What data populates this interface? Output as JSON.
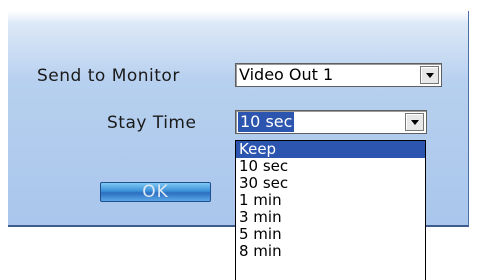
{
  "dialog": {
    "send_label": "Send to Monitor",
    "send_value": "Video Out 1",
    "stay_label": "Stay Time",
    "stay_value": "10 sec",
    "ok_label": "OK"
  },
  "dropdown": {
    "options": [
      "Keep",
      "10 sec",
      "30 sec",
      "1 min",
      "3 min",
      "5 min",
      "8 min"
    ],
    "highlighted": "Keep"
  },
  "colors": {
    "selection": "#2c55b0",
    "ok_button": "#3a90d8",
    "dialog_bg": "#b7d0ef"
  }
}
